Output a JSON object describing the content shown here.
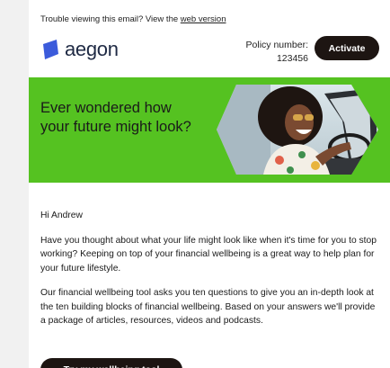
{
  "preheader": {
    "text": "Trouble viewing this email? View the ",
    "link": "web version"
  },
  "brand": {
    "logo_text": "aegon",
    "logo_icon": "aegon-logo-icon",
    "logo_color": "#3b5bdb"
  },
  "header": {
    "policy_label": "Policy number:",
    "policy_number": "123456",
    "activate_label": "Activate"
  },
  "hero": {
    "title": "Ever wondered how your future might look?",
    "background_color": "#55c221",
    "image": "woman-in-convertible-photo"
  },
  "body": {
    "greeting": "Hi Andrew",
    "paragraph_1": "Have you thought about what your life might look like when it's time for you to stop working? Keeping on top of your financial wellbeing is a great way to help plan for your future lifestyle.",
    "paragraph_2": "Our financial wellbeing tool asks you ten questions to give you an in-depth look at the ten building blocks of financial wellbeing. Based on your answers we'll provide a package of articles, resources, videos and podcasts."
  },
  "cta": {
    "label": "Try my wellbeing tool"
  },
  "colors": {
    "button": "#1d1512",
    "text": "#1a1a1a"
  }
}
